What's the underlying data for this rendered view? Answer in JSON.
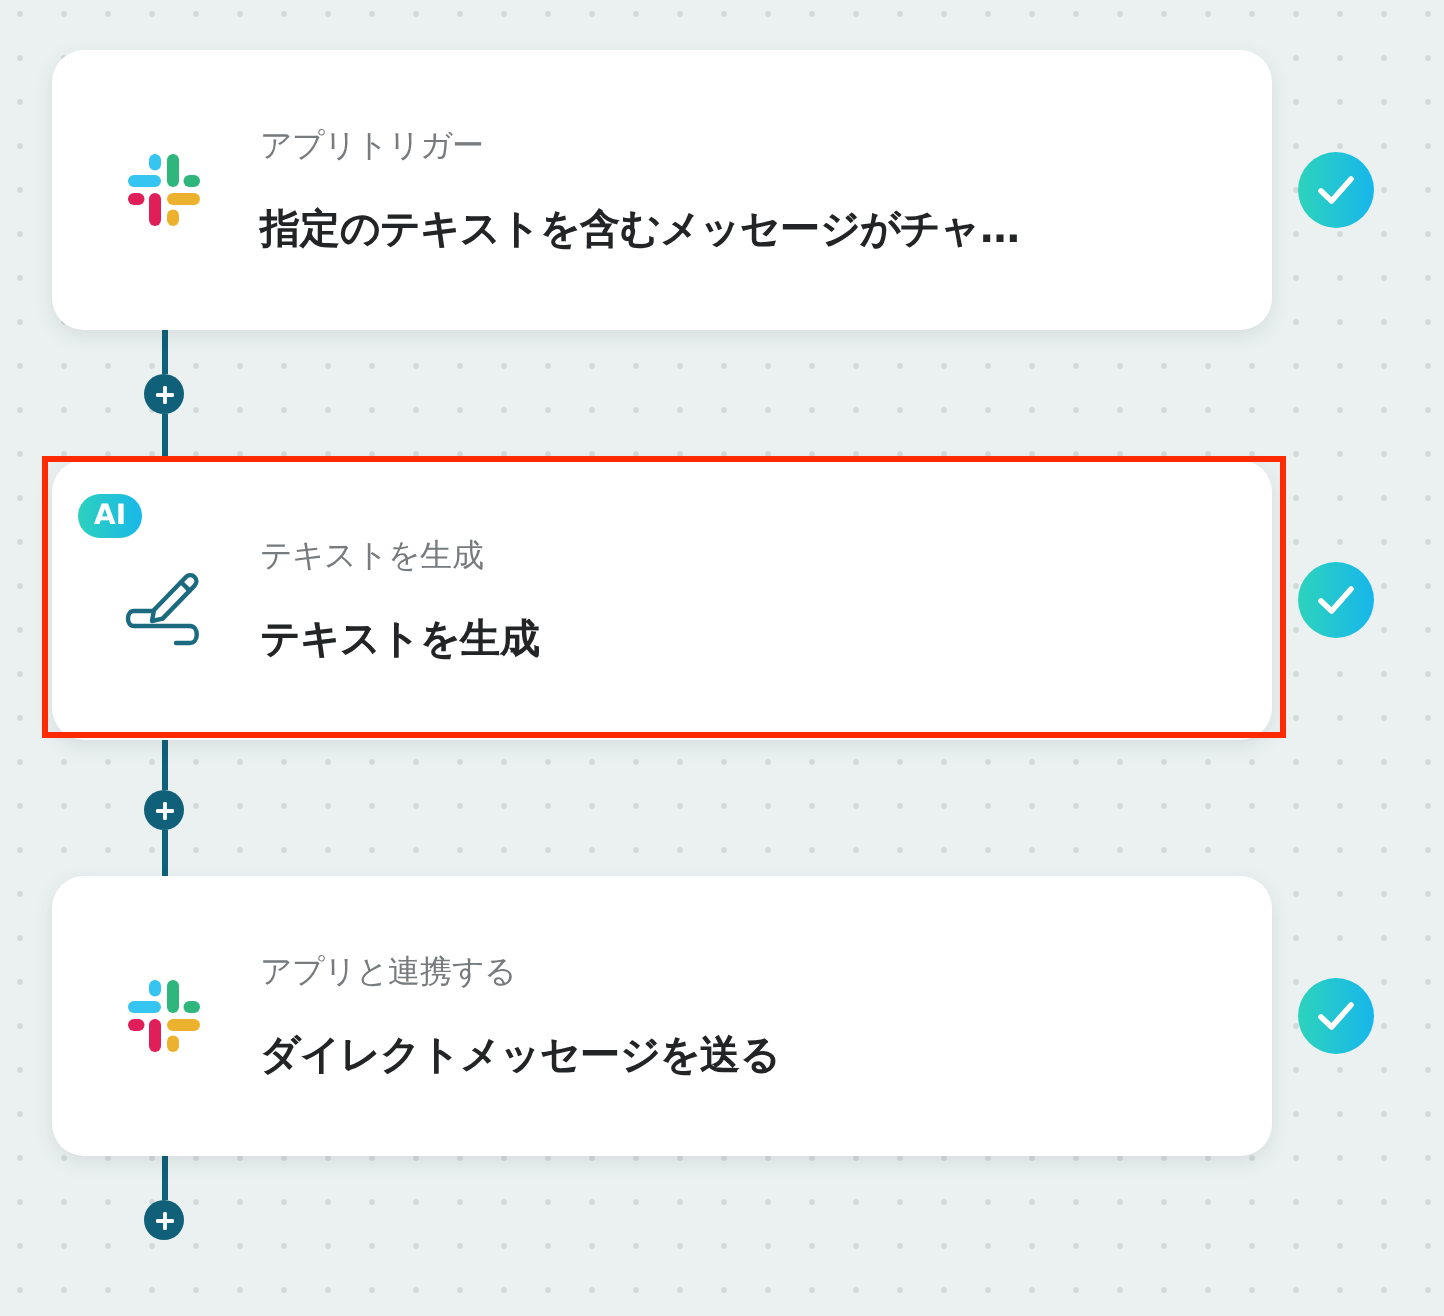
{
  "steps": [
    {
      "kind": "app",
      "label": "アプリトリガー",
      "title": "指定のテキストを含むメッセージがチャ…",
      "done": true,
      "highlighted": false
    },
    {
      "kind": "ai",
      "badge": "AI",
      "label": "テキストを生成",
      "title": "テキストを生成",
      "done": true,
      "highlighted": true
    },
    {
      "kind": "app",
      "label": "アプリと連携する",
      "title": "ダイレクトメッセージを送る",
      "done": true,
      "highlighted": false
    }
  ]
}
